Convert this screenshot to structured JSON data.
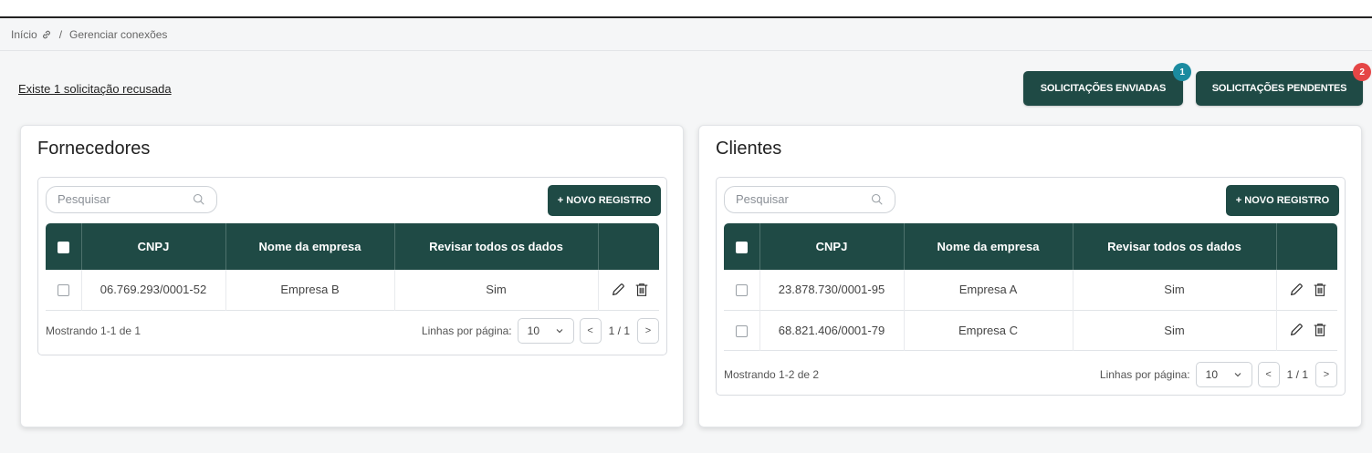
{
  "breadcrumb": {
    "home": "Início",
    "separator": "/",
    "current": "Gerenciar conexões"
  },
  "notice": "Existe 1 solicitação recusada",
  "buttons": {
    "sent": {
      "label": "SOLICITAÇÕES ENVIADAS",
      "badge": "1",
      "badge_color": "#1b8ba0"
    },
    "pending": {
      "label": "SOLICITAÇÕES PENDENTES",
      "badge": "2",
      "badge_color": "#e54646"
    }
  },
  "colors": {
    "primary": "#1f4a45"
  },
  "suppliers": {
    "title": "Fornecedores",
    "search_placeholder": "Pesquisar",
    "new_label": "+ NOVO REGISTRO",
    "columns": [
      "CNPJ",
      "Nome da empresa",
      "Revisar todos os dados"
    ],
    "rows": [
      {
        "cnpj": "06.769.293/0001-52",
        "name": "Empresa B",
        "review": "Sim"
      }
    ],
    "showing": "Mostrando 1-1 de 1",
    "rows_per_page_label": "Linhas por página:",
    "rows_per_page": "10",
    "page": "1 / 1"
  },
  "clients": {
    "title": "Clientes",
    "search_placeholder": "Pesquisar",
    "new_label": "+ NOVO REGISTRO",
    "columns": [
      "CNPJ",
      "Nome da empresa",
      "Revisar todos os dados"
    ],
    "rows": [
      {
        "cnpj": "23.878.730/0001-95",
        "name": "Empresa A",
        "review": "Sim"
      },
      {
        "cnpj": "68.821.406/0001-79",
        "name": "Empresa C",
        "review": "Sim"
      }
    ],
    "showing": "Mostrando 1-2 de 2",
    "rows_per_page_label": "Linhas por página:",
    "rows_per_page": "10",
    "page": "1 / 1"
  }
}
